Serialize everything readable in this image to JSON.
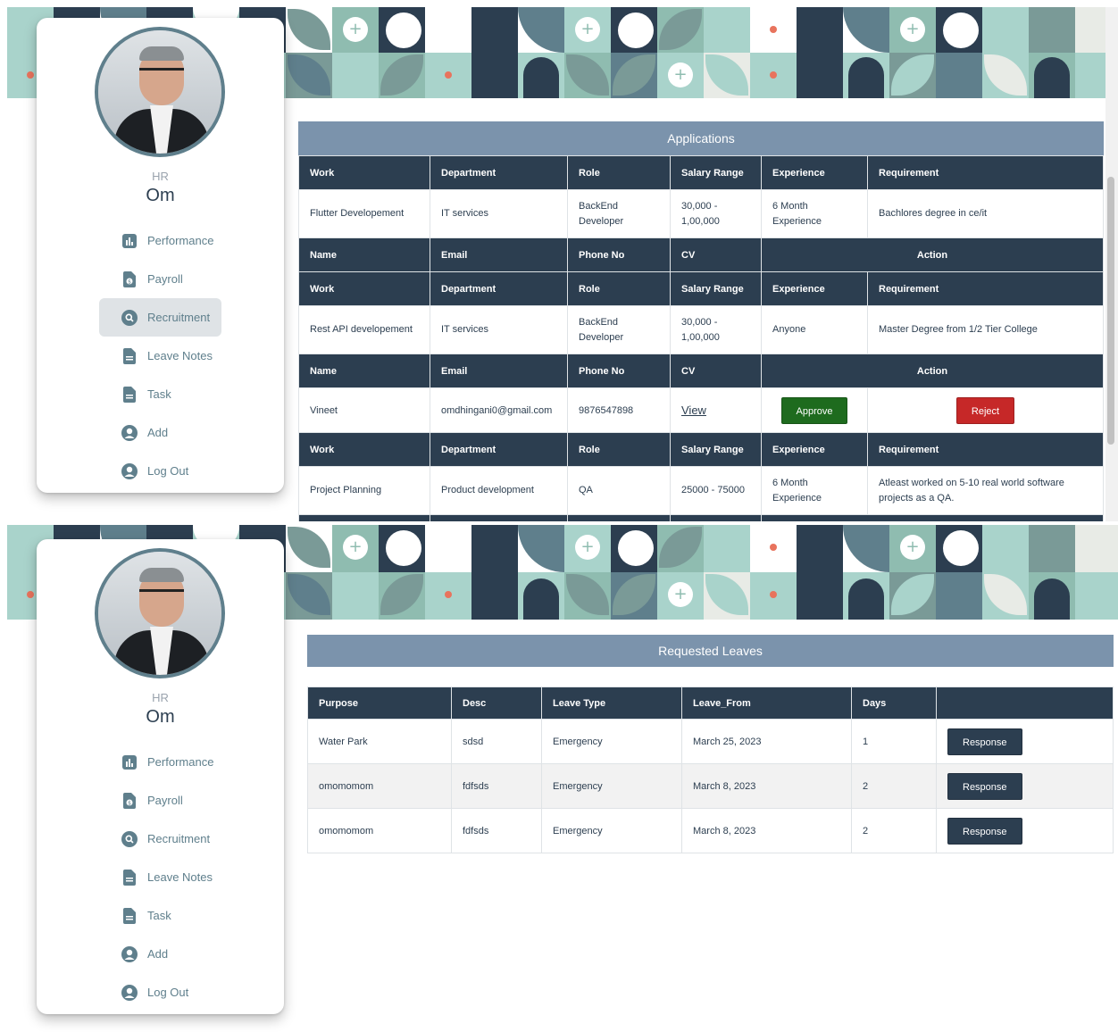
{
  "profile": {
    "role": "HR",
    "name": "Om"
  },
  "nav": {
    "performance": "Performance",
    "payroll": "Payroll",
    "recruitment": "Recruitment",
    "leave_notes": "Leave Notes",
    "task": "Task",
    "add": "Add",
    "logout": "Log Out"
  },
  "applications": {
    "title": "Applications",
    "job_headers": [
      "Work",
      "Department",
      "Role",
      "Salary Range",
      "Experience",
      "Requirement"
    ],
    "applicant_headers": [
      "Name",
      "Email",
      "Phone No",
      "CV",
      "Action"
    ],
    "jobs": [
      {
        "work": "Flutter Developement",
        "department": "IT services",
        "role": "BackEnd Developer",
        "salary": "30,000 - 1,00,000",
        "experience": "6 Month Experience",
        "requirement": "Bachlores degree in ce/it"
      },
      {
        "work": "Rest API developement",
        "department": "IT services",
        "role": "BackEnd Developer",
        "salary": "30,000 - 1,00,000",
        "experience": "Anyone",
        "requirement": "Master Degree from 1/2 Tier College"
      },
      {
        "work": "Project Planning",
        "department": "Product development",
        "role": "QA",
        "salary": "25000 - 75000",
        "experience": "6 Month Experience",
        "requirement": "Atleast worked on 5-10 real world software projects as a QA."
      }
    ],
    "applicant": {
      "name": "Vineet",
      "email": "omdhingani0@gmail.com",
      "phone": "9876547898",
      "cv": "View",
      "approve": "Approve",
      "reject": "Reject"
    }
  },
  "leaves": {
    "title": "Requested Leaves",
    "headers": [
      "Purpose",
      "Desc",
      "Leave Type",
      "Leave_From",
      "Days",
      ""
    ],
    "rows": [
      {
        "purpose": "Water Park",
        "desc": "sdsd",
        "type": "Emergency",
        "from": "March 25, 2023",
        "days": "1",
        "action": "Response"
      },
      {
        "purpose": "omomomom",
        "desc": "fdfsds",
        "type": "Emergency",
        "from": "March 8, 2023",
        "days": "2",
        "action": "Response"
      },
      {
        "purpose": "omomomom",
        "desc": "fdfsds",
        "type": "Emergency",
        "from": "March 8, 2023",
        "days": "2",
        "action": "Response"
      }
    ]
  },
  "colors": {
    "primary": "#2c3e50",
    "title_bar": "#7b93ac",
    "approve": "#1e6b1e",
    "reject": "#c62828",
    "accent_dot": "#e8735d",
    "mint": "#a9d3cb"
  }
}
